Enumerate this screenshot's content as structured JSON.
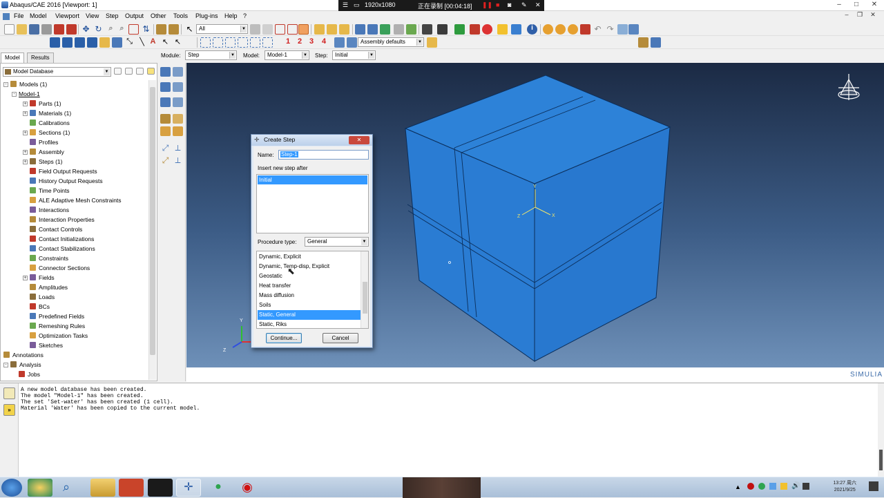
{
  "window": {
    "title": "Abaqus/CAE 2016 [Viewport: 1]"
  },
  "recorder": {
    "resolution": "1920x1080",
    "status": "正在录制 [00:04:18]"
  },
  "menubar": {
    "items": [
      "File",
      "Model",
      "Viewport",
      "View",
      "Step",
      "Output",
      "Other",
      "Tools",
      "Plug-ins",
      "Help",
      "?"
    ]
  },
  "toolbar": {
    "selection_filter": "All",
    "render_numbers": [
      "1",
      "2",
      "3",
      "4"
    ],
    "assembly_display": "Assembly defaults"
  },
  "context": {
    "module_label": "Module:",
    "module_value": "Step",
    "model_label": "Model:",
    "model_value": "Model-1",
    "step_label": "Step:",
    "step_value": "Initial"
  },
  "tabs": [
    "Model",
    "Results"
  ],
  "tree": {
    "database": "Model Database",
    "nodes": [
      {
        "label": "Models (1)",
        "level": 0,
        "exp": "-",
        "icon": "models-icon"
      },
      {
        "label": "Model-1",
        "level": 1,
        "exp": "-",
        "icon": ""
      },
      {
        "label": "Parts (1)",
        "level": 2,
        "exp": "+",
        "icon": "parts-icon"
      },
      {
        "label": "Materials (1)",
        "level": 2,
        "exp": "+",
        "icon": "materials-icon"
      },
      {
        "label": "Calibrations",
        "level": 2,
        "exp": "",
        "icon": "calibrations-icon"
      },
      {
        "label": "Sections (1)",
        "level": 2,
        "exp": "+",
        "icon": "sections-icon"
      },
      {
        "label": "Profiles",
        "level": 2,
        "exp": "",
        "icon": "profiles-icon"
      },
      {
        "label": "Assembly",
        "level": 2,
        "exp": "+",
        "icon": "assembly-icon"
      },
      {
        "label": "Steps (1)",
        "level": 2,
        "exp": "+",
        "icon": "steps-icon"
      },
      {
        "label": "Field Output Requests",
        "level": 2,
        "exp": "",
        "icon": "field-output-icon"
      },
      {
        "label": "History Output Requests",
        "level": 2,
        "exp": "",
        "icon": "history-output-icon"
      },
      {
        "label": "Time Points",
        "level": 2,
        "exp": "",
        "icon": "time-points-icon"
      },
      {
        "label": "ALE Adaptive Mesh Constraints",
        "level": 2,
        "exp": "",
        "icon": "ale-icon"
      },
      {
        "label": "Interactions",
        "level": 2,
        "exp": "",
        "icon": "interactions-icon"
      },
      {
        "label": "Interaction Properties",
        "level": 2,
        "exp": "",
        "icon": "interaction-properties-icon"
      },
      {
        "label": "Contact Controls",
        "level": 2,
        "exp": "",
        "icon": "contact-controls-icon"
      },
      {
        "label": "Contact Initializations",
        "level": 2,
        "exp": "",
        "icon": "contact-init-icon"
      },
      {
        "label": "Contact Stabilizations",
        "level": 2,
        "exp": "",
        "icon": "contact-stab-icon"
      },
      {
        "label": "Constraints",
        "level": 2,
        "exp": "",
        "icon": "constraints-icon"
      },
      {
        "label": "Connector Sections",
        "level": 2,
        "exp": "",
        "icon": "connector-icon"
      },
      {
        "label": "Fields",
        "level": 2,
        "exp": "+",
        "icon": "fields-icon"
      },
      {
        "label": "Amplitudes",
        "level": 2,
        "exp": "",
        "icon": "amplitudes-icon"
      },
      {
        "label": "Loads",
        "level": 2,
        "exp": "",
        "icon": "loads-icon"
      },
      {
        "label": "BCs",
        "level": 2,
        "exp": "",
        "icon": "bcs-icon"
      },
      {
        "label": "Predefined Fields",
        "level": 2,
        "exp": "",
        "icon": "predefined-icon"
      },
      {
        "label": "Remeshing Rules",
        "level": 2,
        "exp": "",
        "icon": "remeshing-icon"
      },
      {
        "label": "Optimization Tasks",
        "level": 2,
        "exp": "",
        "icon": "optimization-icon"
      },
      {
        "label": "Sketches",
        "level": 2,
        "exp": "",
        "icon": "sketches-icon"
      },
      {
        "label": "Annotations",
        "level": 0,
        "exp": "",
        "icon": "annotations-icon"
      },
      {
        "label": "Analysis",
        "level": 0,
        "exp": "-",
        "icon": "analysis-icon"
      },
      {
        "label": "Jobs",
        "level": 1,
        "exp": "",
        "icon": "jobs-icon"
      }
    ]
  },
  "triad": {
    "x": "X",
    "y": "Y",
    "z": "Z"
  },
  "part_csys": {
    "x": "X",
    "y": "Y",
    "z": "Z"
  },
  "brand": "SIMULIA",
  "dialog": {
    "title": "Create Step",
    "close": "✕",
    "name_label": "Name:",
    "name_value": "Step-1",
    "insert_label": "Insert new step after",
    "insert_items": [
      "Initial"
    ],
    "procedure_label": "Procedure type:",
    "procedure_value": "General",
    "procedures": [
      "Dynamic, Explicit",
      "Dynamic, Temp-disp, Explicit",
      "Geostatic",
      "Heat transfer",
      "Mass diffusion",
      "Soils",
      "Static, General",
      "Static, Riks"
    ],
    "selected_procedure": "Static, General",
    "continue": "Continue...",
    "cancel": "Cancel"
  },
  "messages": [
    "A new model database has been created.",
    "The model \"Model-1\" has been created.",
    "The set 'Set-water' has been created (1 cell).",
    "Material 'Water' has been copied to the current model."
  ],
  "taskbar": {
    "time": "13:27 周六",
    "date": "2021/9/25"
  },
  "colors": {
    "accent": "#3399ff",
    "part_blue": "#2e7fd3",
    "viewport_top": "#1b2a44",
    "viewport_bottom": "#6e90b8"
  }
}
